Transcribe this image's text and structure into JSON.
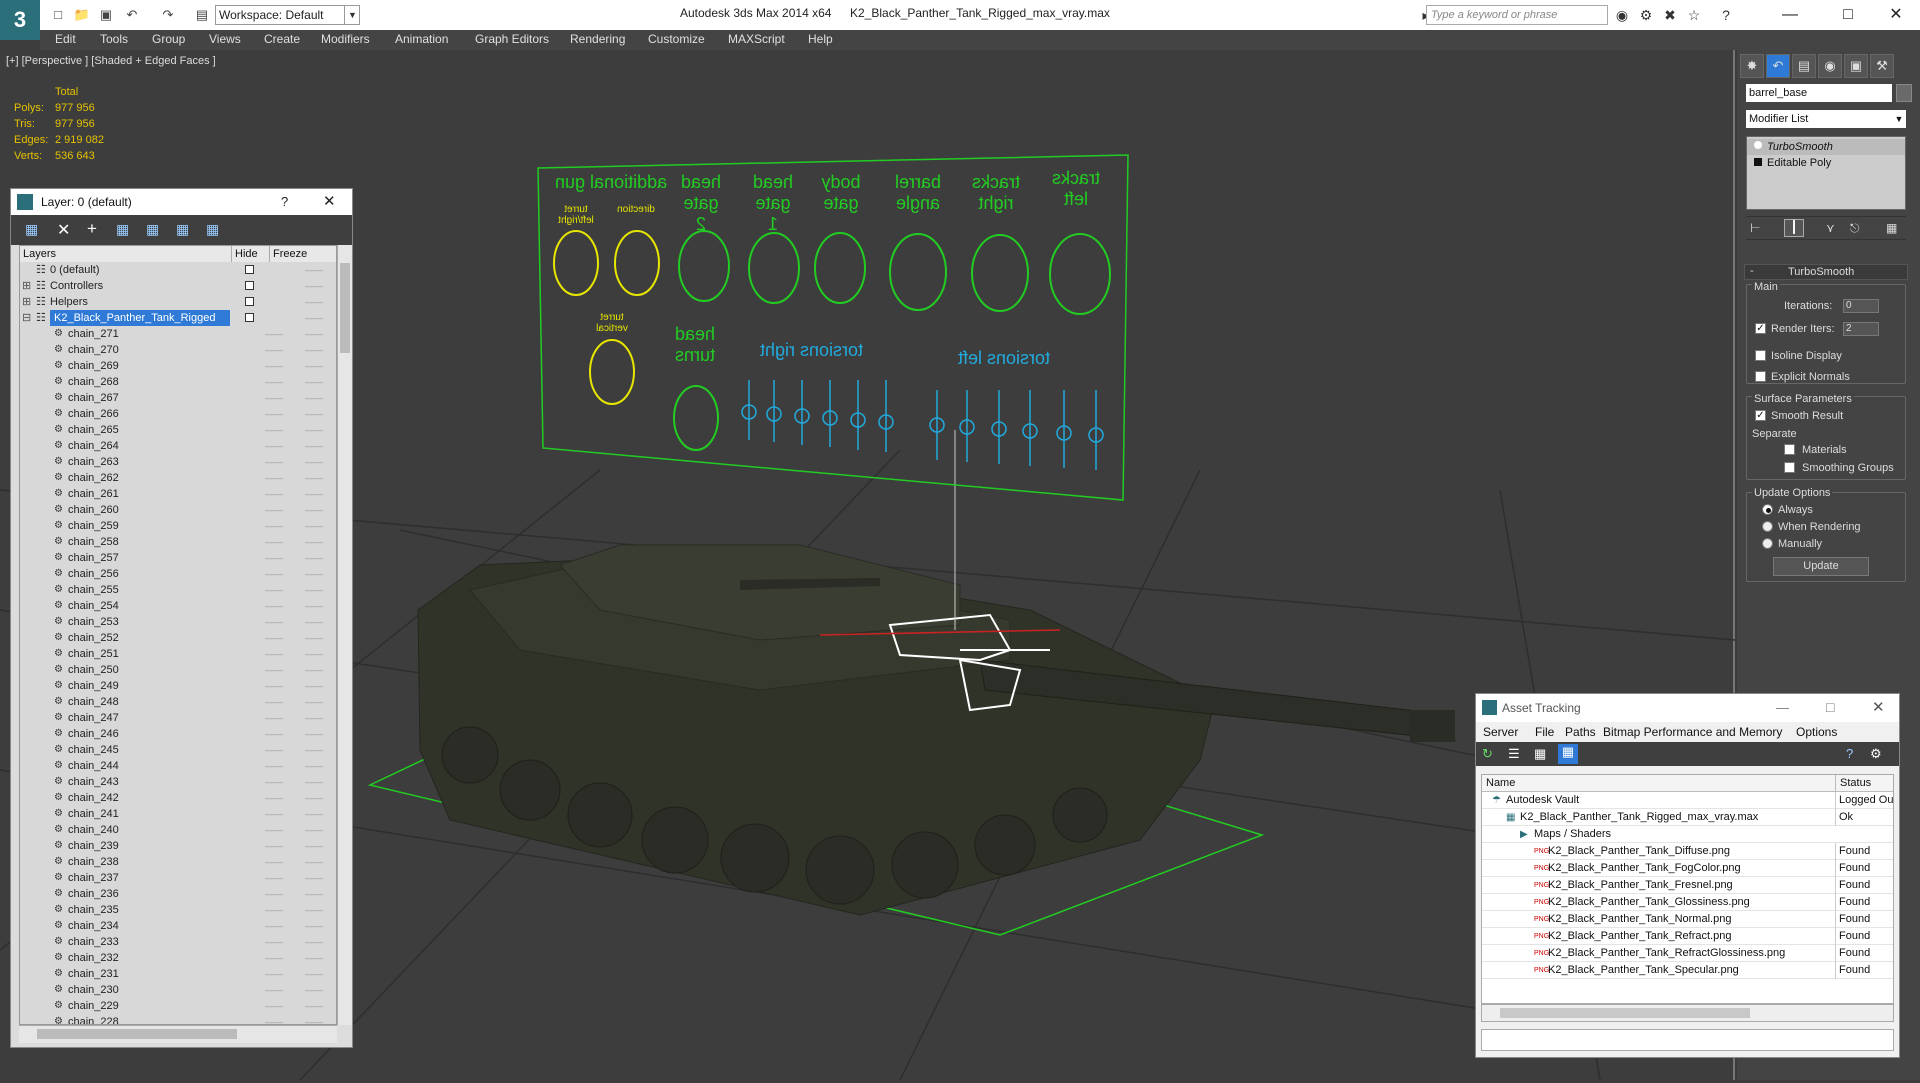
{
  "app": {
    "title": "Autodesk 3ds Max  2014 x64",
    "file": "K2_Black_Panther_Tank_Rigged_max_vray.max",
    "workspace": "Workspace: Default",
    "search_placeholder": "Type a keyword or phrase"
  },
  "menu": [
    "Edit",
    "Tools",
    "Group",
    "Views",
    "Create",
    "Modifiers",
    "Animation",
    "Graph Editors",
    "Rendering",
    "Customize",
    "MAXScript",
    "Help"
  ],
  "viewport": {
    "label": "[+] [Perspective ] [Shaded + Edged Faces ]",
    "stats": {
      "total": "Total",
      "polys_label": "Polys:",
      "polys": "977 956",
      "tris_label": "Tris:",
      "tris": "977 956",
      "edges_label": "Edges:",
      "edges": "2 919 082",
      "verts_label": "Verts:",
      "verts": "536 643"
    },
    "board_labels": [
      "additional gun",
      "head gate 2",
      "head gate 1",
      "body gate",
      "barrel angle",
      "tracks right",
      "tracks left"
    ],
    "board_sublabels": [
      "turret left/right",
      "direction"
    ],
    "board_row2": [
      "turret vertical",
      "head turns",
      "torsions right",
      "torsions left"
    ]
  },
  "layer_panel": {
    "title": "Layer: 0 (default)",
    "help": "?",
    "columns": {
      "layers": "Layers",
      "hide": "Hide",
      "freeze": "Freeze"
    },
    "top_rows": [
      "0 (default)",
      "Controllers",
      "Helpers",
      "K2_Black_Panther_Tank_Rigged"
    ],
    "chains": [
      "chain_271",
      "chain_270",
      "chain_269",
      "chain_268",
      "chain_267",
      "chain_266",
      "chain_265",
      "chain_264",
      "chain_263",
      "chain_262",
      "chain_261",
      "chain_260",
      "chain_259",
      "chain_258",
      "chain_257",
      "chain_256",
      "chain_255",
      "chain_254",
      "chain_253",
      "chain_252",
      "chain_251",
      "chain_250",
      "chain_249",
      "chain_248",
      "chain_247",
      "chain_246",
      "chain_245",
      "chain_244",
      "chain_243",
      "chain_242",
      "chain_241",
      "chain_240",
      "chain_239",
      "chain_238",
      "chain_237",
      "chain_236",
      "chain_235",
      "chain_234",
      "chain_233",
      "chain_232",
      "chain_231",
      "chain_230",
      "chain_229",
      "chain_228"
    ]
  },
  "command_panel": {
    "object_name": "barrel_base",
    "modifier_list": "Modifier List",
    "stack": [
      "TurboSmooth",
      "Editable Poly"
    ],
    "rollout_title": "TurboSmooth",
    "main": "Main",
    "iterations_label": "Iterations:",
    "iterations": "0",
    "render_iters_label": "Render Iters:",
    "render_iters": "2",
    "isoline": "Isoline Display",
    "explicit": "Explicit Normals",
    "surface": "Surface Parameters",
    "smooth_result": "Smooth Result",
    "separate": "Separate",
    "materials": "Materials",
    "smoothing_groups": "Smoothing Groups",
    "update_options": "Update Options",
    "always": "Always",
    "when_rendering": "When Rendering",
    "manually": "Manually",
    "update_btn": "Update"
  },
  "asset_tracking": {
    "title": "Asset Tracking",
    "menu": [
      "Server",
      "File",
      "Paths",
      "Bitmap Performance and Memory",
      "Options"
    ],
    "col_name": "Name",
    "col_status": "Status",
    "rows": [
      {
        "name": "Autodesk Vault",
        "status": "Logged Out"
      },
      {
        "name": "K2_Black_Panther_Tank_Rigged_max_vray.max",
        "status": "Ok"
      },
      {
        "name": "Maps / Shaders",
        "status": ""
      },
      {
        "name": "K2_Black_Panther_Tank_Diffuse.png",
        "status": "Found"
      },
      {
        "name": "K2_Black_Panther_Tank_FogColor.png",
        "status": "Found"
      },
      {
        "name": "K2_Black_Panther_Tank_Fresnel.png",
        "status": "Found"
      },
      {
        "name": "K2_Black_Panther_Tank_Glossiness.png",
        "status": "Found"
      },
      {
        "name": "K2_Black_Panther_Tank_Normal.png",
        "status": "Found"
      },
      {
        "name": "K2_Black_Panther_Tank_Refract.png",
        "status": "Found"
      },
      {
        "name": "K2_Black_Panther_Tank_RefractGlossiness.png",
        "status": "Found"
      },
      {
        "name": "K2_Black_Panther_Tank_Specular.png",
        "status": "Found"
      }
    ]
  },
  "colors": {
    "accent": "#2a6f7a",
    "selection": "#2e7ad6",
    "stats": "#e6c200",
    "board_green": "#22cc22",
    "board_cyan": "#22aadd",
    "helper_yellow": "#e6e600"
  }
}
